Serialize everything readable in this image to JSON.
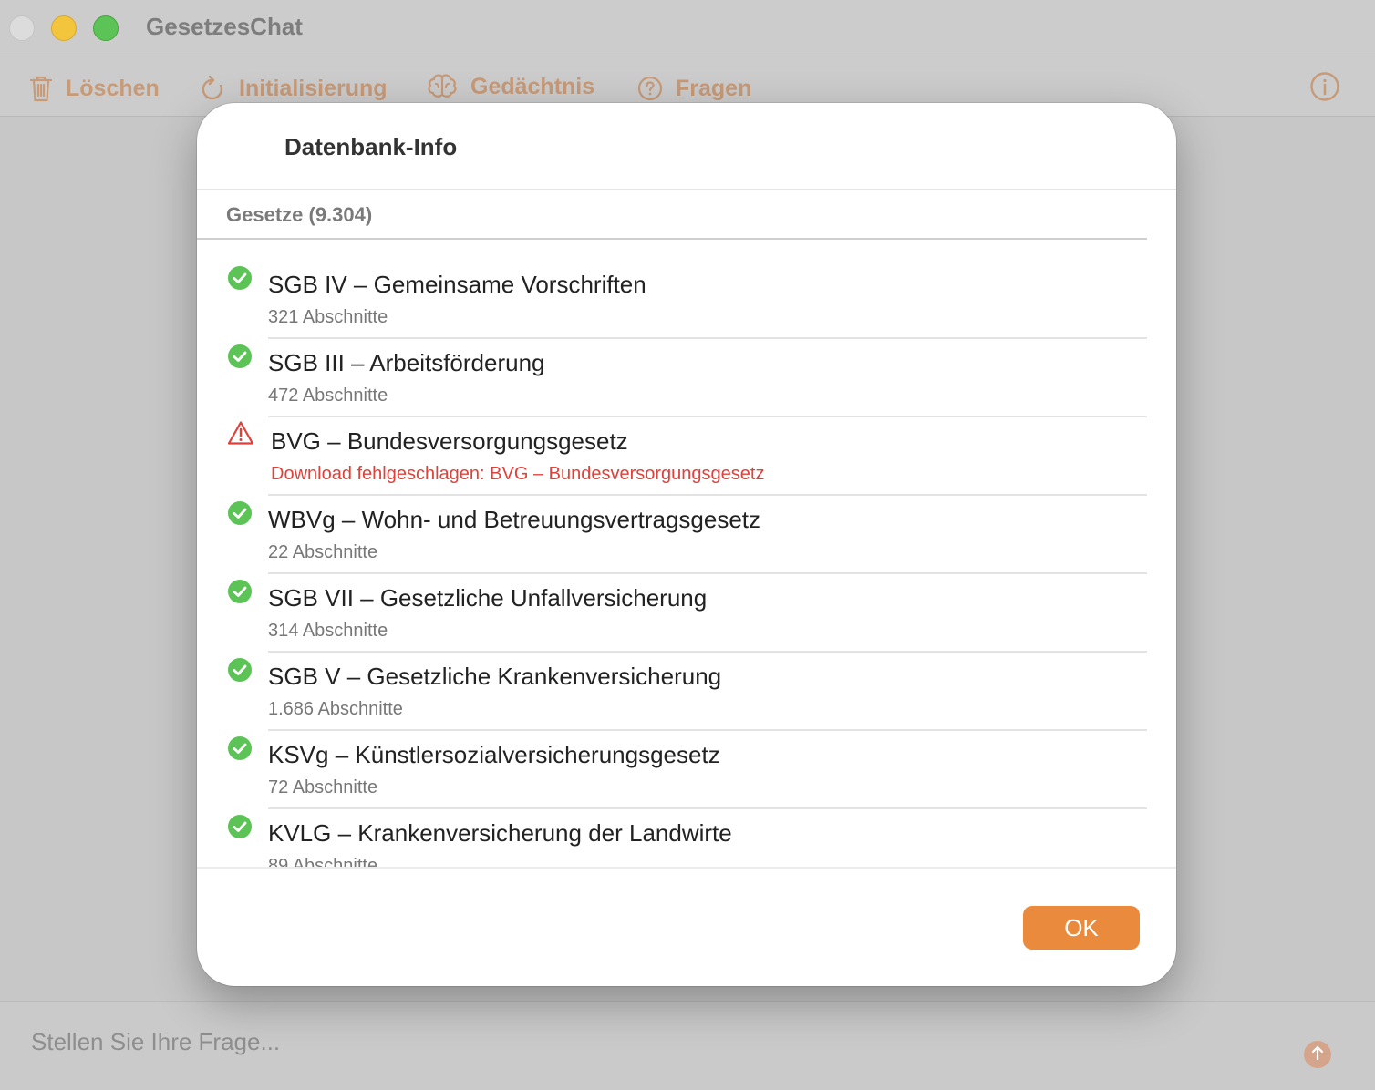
{
  "window": {
    "title": "GesetzesChat"
  },
  "toolbar": {
    "delete_label": "Löschen",
    "init_label": "Initialisierung",
    "memory_label": "Gedächtnis",
    "questions_label": "Fragen"
  },
  "input": {
    "placeholder": "Stellen Sie Ihre Frage..."
  },
  "sheet": {
    "title": "Datenbank-Info",
    "section_header": "Gesetze (9.304)",
    "ok_label": "OK",
    "laws": [
      {
        "name": "SGB IV – Gemeinsame Vorschriften",
        "detail": "321 Abschnitte",
        "status": "ok"
      },
      {
        "name": "SGB III – Arbeitsförderung",
        "detail": "472 Abschnitte",
        "status": "ok"
      },
      {
        "name": "BVG – Bundesversorgungsgesetz",
        "detail": "Download fehlgeschlagen: BVG – Bundesversorgungsgesetz",
        "status": "error"
      },
      {
        "name": "WBVg – Wohn- und Betreuungsvertragsgesetz",
        "detail": "22 Abschnitte",
        "status": "ok"
      },
      {
        "name": "SGB VII – Gesetzliche Unfallversicherung",
        "detail": "314 Abschnitte",
        "status": "ok"
      },
      {
        "name": "SGB V – Gesetzliche Krankenversicherung",
        "detail": "1.686 Abschnitte",
        "status": "ok"
      },
      {
        "name": "KSVg – Künstlersozialversicherungsgesetz",
        "detail": "72 Abschnitte",
        "status": "ok"
      },
      {
        "name": "KVLG – Krankenversicherung der Landwirte",
        "detail": "89 Abschnitte",
        "status": "ok"
      }
    ]
  },
  "colors": {
    "accent": "#e98a3d",
    "success": "#5cc356",
    "error": "#e0413a"
  },
  "icons": {
    "delete": "trash-icon",
    "init": "refresh-icon",
    "memory": "brain-icon",
    "questions": "question-circle-icon",
    "info": "info-circle-icon",
    "ok_status": "checkmark-circle-icon",
    "error_status": "warning-triangle-icon",
    "send": "arrow-up-icon"
  }
}
